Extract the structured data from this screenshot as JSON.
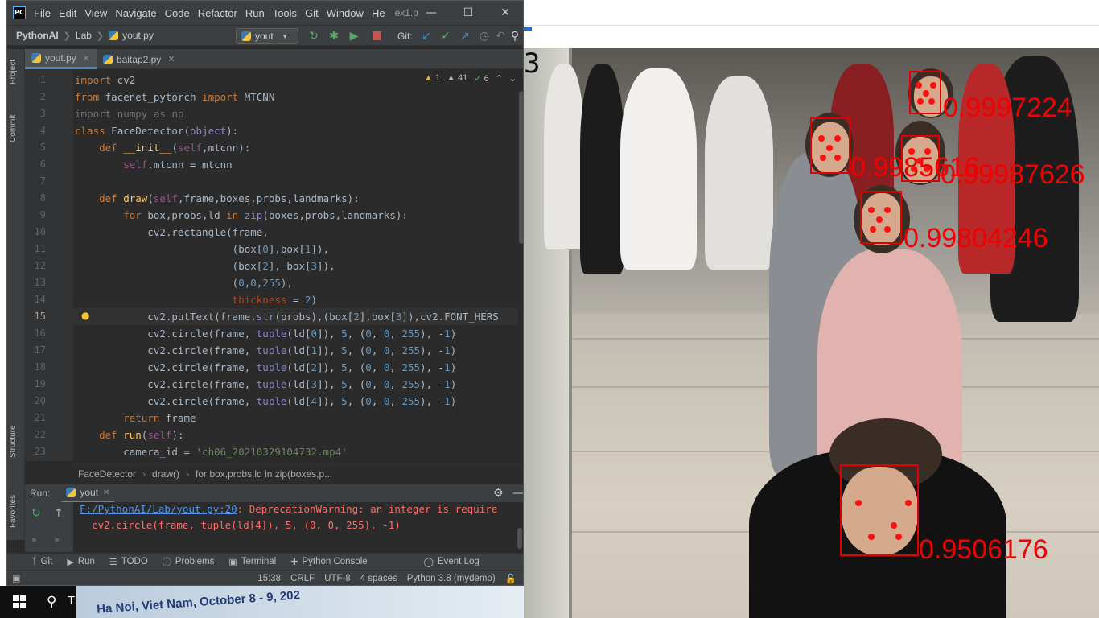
{
  "ide": {
    "menu": [
      "File",
      "Edit",
      "View",
      "Navigate",
      "Code",
      "Refactor",
      "Run",
      "Tools",
      "Git",
      "Window",
      "He"
    ],
    "window_title": "ex1.p",
    "breadcrumbs": [
      "PythonAI",
      "Lab",
      "yout.py"
    ],
    "run_config": "yout",
    "git_label": "Git:",
    "tabs": [
      {
        "label": "yout.py",
        "active": true
      },
      {
        "label": "baitap2.py",
        "active": false
      }
    ],
    "side_tabs": {
      "project": "Project",
      "commit": "Commit",
      "structure": "Structure",
      "favorites": "Favorites"
    },
    "inspections": {
      "warnings": "1",
      "weak_warnings": "41",
      "typos": "6"
    },
    "code_lines": [
      {
        "n": "1",
        "text": "import cv2"
      },
      {
        "n": "2",
        "text": "from facenet_pytorch import MTCNN"
      },
      {
        "n": "3",
        "text": "import numpy as np"
      },
      {
        "n": "4",
        "text": "class FaceDetector(object):"
      },
      {
        "n": "5",
        "text": "    def __init__(self,mtcnn):"
      },
      {
        "n": "6",
        "text": "        self.mtcnn = mtcnn"
      },
      {
        "n": "7",
        "text": ""
      },
      {
        "n": "8",
        "text": "    def draw(self,frame,boxes,probs,landmarks):"
      },
      {
        "n": "9",
        "text": "        for box,probs,ld in zip(boxes,probs,landmarks):"
      },
      {
        "n": "10",
        "text": "            cv2.rectangle(frame,"
      },
      {
        "n": "11",
        "text": "                          (box[0],box[1]),"
      },
      {
        "n": "12",
        "text": "                          (box[2], box[3]),"
      },
      {
        "n": "13",
        "text": "                          (0,0,255),"
      },
      {
        "n": "14",
        "text": "                          thickness = 2)"
      },
      {
        "n": "15",
        "text": "            cv2.putText(frame,str(probs),(box[2],box[3]),cv2.FONT_HERS"
      },
      {
        "n": "16",
        "text": "            cv2.circle(frame, tuple(ld[0]), 5, (0, 0, 255), -1)"
      },
      {
        "n": "17",
        "text": "            cv2.circle(frame, tuple(ld[1]), 5, (0, 0, 255), -1)"
      },
      {
        "n": "18",
        "text": "            cv2.circle(frame, tuple(ld[2]), 5, (0, 0, 255), -1)"
      },
      {
        "n": "19",
        "text": "            cv2.circle(frame, tuple(ld[3]), 5, (0, 0, 255), -1)"
      },
      {
        "n": "20",
        "text": "            cv2.circle(frame, tuple(ld[4]), 5, (0, 0, 255), -1)"
      },
      {
        "n": "21",
        "text": "        return frame"
      },
      {
        "n": "22",
        "text": "    def run(self):"
      },
      {
        "n": "23",
        "text": "        camera_id = 'ch06_20210329104732.mp4'"
      }
    ],
    "current_line": "15",
    "breadcrumb_bar": [
      "FaceDetector",
      "draw()",
      "for box,probs,ld in zip(boxes,p..."
    ],
    "run_panel": {
      "label": "Run:",
      "tab": "yout",
      "console_link": "F:/PythonAI/Lab/yout.py:20",
      "console_line1_rest": ": DeprecationWarning: an integer is require",
      "console_line2": "  cv2.circle(frame, tuple(ld[4]), 5, (0, 0, 255), -1)"
    },
    "tool_windows": [
      "Git",
      "Run",
      "TODO",
      "Problems",
      "Terminal",
      "Python Console",
      "Event Log"
    ],
    "status": {
      "position": "15:38",
      "line_sep": "CRLF",
      "encoding": "UTF-8",
      "indent": "4 spaces",
      "interpreter": "Python 3.8 (mydemo)"
    }
  },
  "video": {
    "frame_label": "3",
    "detections": [
      "0.9997224",
      "0.9985616",
      "0.99987626",
      "0.99804246",
      "0.9506176"
    ]
  },
  "desktop": {
    "taskbar_search": "T",
    "banner": "Ha Noi, Viet Nam, October 8 - 9, 202"
  },
  "colors": {
    "accent": "#4a88c7",
    "box": "#e00000",
    "editor_bg": "#2b2b2b"
  }
}
